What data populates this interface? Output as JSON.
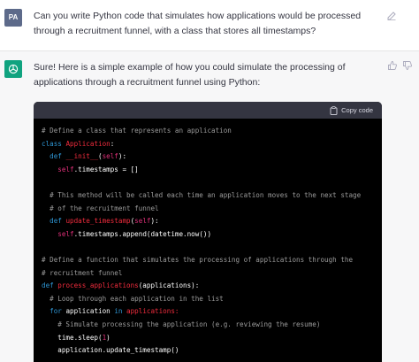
{
  "user": {
    "avatar_initials": "PA",
    "message": "Can you write Python code that simulates how applications would be processed through a recruitment funnel, with a class that stores all timestamps?"
  },
  "assistant": {
    "message": "Sure! Here is a simple example of how you could simulate the processing of applications through a recruitment funnel using Python:",
    "copy_label": "Copy code",
    "code_lines": [
      [
        {
          "t": "# Define a class that represents an application",
          "c": "comment"
        }
      ],
      [
        {
          "t": "class ",
          "c": "kw"
        },
        {
          "t": "Application",
          "c": "fn"
        },
        {
          "t": ":",
          "c": "plain"
        }
      ],
      [
        {
          "t": "  def ",
          "c": "kw"
        },
        {
          "t": "__init__",
          "c": "fn"
        },
        {
          "t": "(",
          "c": "plain"
        },
        {
          "t": "self",
          "c": "self"
        },
        {
          "t": "):",
          "c": "plain"
        }
      ],
      [
        {
          "t": "    ",
          "c": "plain"
        },
        {
          "t": "self",
          "c": "self"
        },
        {
          "t": ".timestamps = []",
          "c": "plain"
        }
      ],
      [
        {
          "t": "",
          "c": "plain"
        }
      ],
      [
        {
          "t": "  # This method will be called each time an application moves to the next stage",
          "c": "comment"
        }
      ],
      [
        {
          "t": "  # of the recruitment funnel",
          "c": "comment"
        }
      ],
      [
        {
          "t": "  def ",
          "c": "kw"
        },
        {
          "t": "update_timestamp",
          "c": "fn"
        },
        {
          "t": "(",
          "c": "plain"
        },
        {
          "t": "self",
          "c": "self"
        },
        {
          "t": "):",
          "c": "plain"
        }
      ],
      [
        {
          "t": "    ",
          "c": "plain"
        },
        {
          "t": "self",
          "c": "self"
        },
        {
          "t": ".timestamps.append(datetime.now())",
          "c": "plain"
        }
      ],
      [
        {
          "t": "",
          "c": "plain"
        }
      ],
      [
        {
          "t": "# Define a function that simulates the processing of applications through the",
          "c": "comment"
        }
      ],
      [
        {
          "t": "# recruitment funnel",
          "c": "comment"
        }
      ],
      [
        {
          "t": "def ",
          "c": "kw"
        },
        {
          "t": "process_applications",
          "c": "fn"
        },
        {
          "t": "(applications):",
          "c": "plain"
        }
      ],
      [
        {
          "t": "  # Loop through each application in the list",
          "c": "comment"
        }
      ],
      [
        {
          "t": "  for ",
          "c": "kw"
        },
        {
          "t": "application ",
          "c": "plain"
        },
        {
          "t": "in ",
          "c": "kw"
        },
        {
          "t": "applications:",
          "c": "fn"
        }
      ],
      [
        {
          "t": "    # Simulate processing the application (e.g. reviewing the resume)",
          "c": "comment"
        }
      ],
      [
        {
          "t": "    time.sleep(",
          "c": "plain"
        },
        {
          "t": "1",
          "c": "num"
        },
        {
          "t": ")",
          "c": "plain"
        }
      ],
      [
        {
          "t": "    application.update_timestamp()",
          "c": "plain"
        }
      ]
    ]
  },
  "colors": {
    "accent_bot": "#10a37f",
    "code_bg": "#000000",
    "code_header_bg": "#343541"
  },
  "icons": [
    "edit-icon",
    "thumbs-up-icon",
    "thumbs-down-icon",
    "clipboard-icon",
    "openai-logo-icon"
  ]
}
